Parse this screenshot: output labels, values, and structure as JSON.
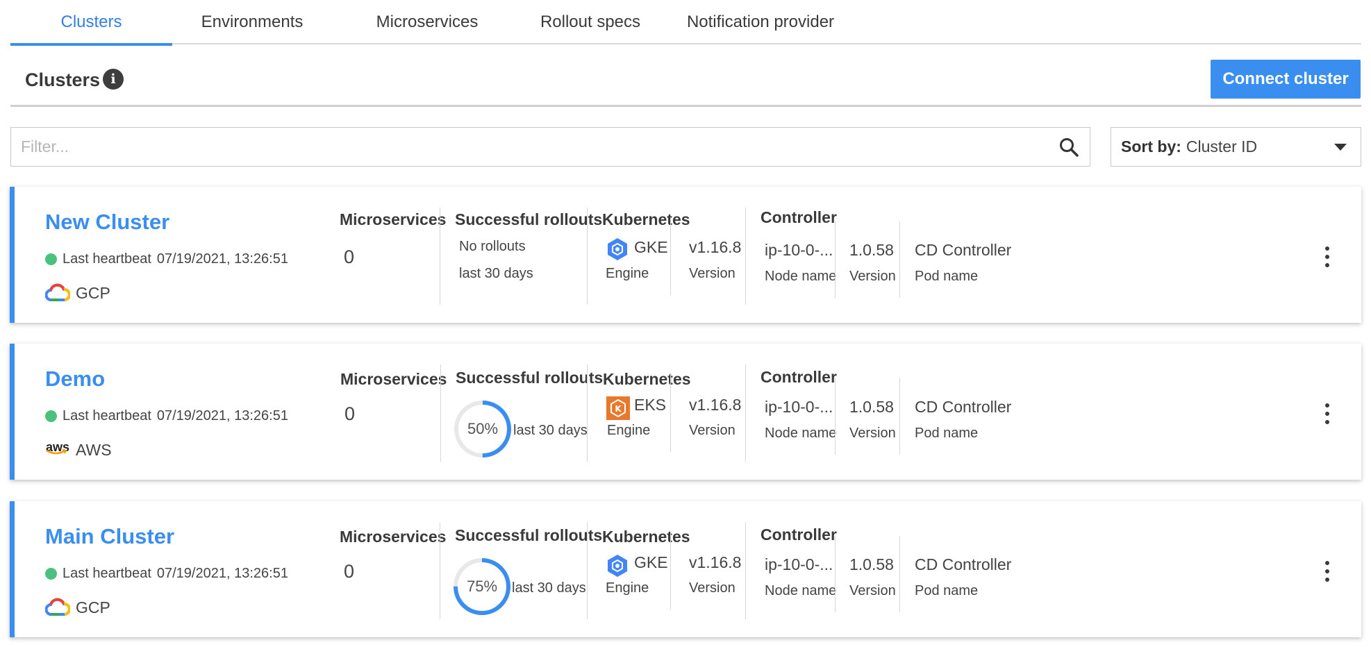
{
  "tabs": [
    {
      "label": "Clusters",
      "active": true
    },
    {
      "label": "Environments",
      "active": false
    },
    {
      "label": "Microservices",
      "active": false
    },
    {
      "label": "Rollout specs",
      "active": false
    },
    {
      "label": "Notification provider",
      "active": false
    }
  ],
  "header": {
    "title": "Clusters",
    "info_icon": "info-icon",
    "connect_button": "Connect cluster"
  },
  "filter": {
    "placeholder": "Filter...",
    "value": "",
    "icon": "search-icon"
  },
  "sort": {
    "label": "Sort by:",
    "value": "Cluster ID",
    "icon": "chevron-down-icon"
  },
  "colors": {
    "accent": "#3a8ef0",
    "status_ok": "#4ac27d",
    "ring_track": "#e8e8e8"
  },
  "clusters": [
    {
      "name": "New Cluster",
      "heartbeat_label": "Last heartbeat",
      "heartbeat_time": "07/19/2021, 13:26:51",
      "provider": "GCP",
      "provider_icon": "gcp-cloud-icon",
      "microservices_label": "Microservices",
      "microservices_count": "0",
      "rollouts_label": "Successful rollouts",
      "rollouts_percent": null,
      "rollouts_text": "No rollouts",
      "rollouts_period": "last 30 days",
      "kubernetes_label": "Kubernetes",
      "engine": "GKE",
      "engine_icon": "gke-icon",
      "engine_label": "Engine",
      "k8s_version": "v1.16.8",
      "version_label": "Version",
      "controller_label": "Controller",
      "node_name": "ip-10-0-...",
      "node_name_label": "Node name",
      "controller_version": "1.0.58",
      "controller_version_label": "Version",
      "pod_name": "CD Controller",
      "pod_name_label": "Pod name"
    },
    {
      "name": "Demo",
      "heartbeat_label": "Last heartbeat",
      "heartbeat_time": "07/19/2021, 13:26:51",
      "provider": "AWS",
      "provider_icon": "aws-logo-icon",
      "provider_logo_text": "aws",
      "microservices_label": "Microservices",
      "microservices_count": "0",
      "rollouts_label": "Successful rollouts",
      "rollouts_percent": 50,
      "rollouts_percent_text": "50%",
      "rollouts_period": "last 30 days",
      "kubernetes_label": "Kubernetes",
      "engine": "EKS",
      "engine_icon": "eks-icon",
      "engine_label": "Engine",
      "k8s_version": "v1.16.8",
      "version_label": "Version",
      "controller_label": "Controller",
      "node_name": "ip-10-0-...",
      "node_name_label": "Node name",
      "controller_version": "1.0.58",
      "controller_version_label": "Version",
      "pod_name": "CD Controller",
      "pod_name_label": "Pod name"
    },
    {
      "name": "Main Cluster",
      "heartbeat_label": "Last heartbeat",
      "heartbeat_time": "07/19/2021, 13:26:51",
      "provider": "GCP",
      "provider_icon": "gcp-cloud-icon",
      "microservices_label": "Microservices",
      "microservices_count": "0",
      "rollouts_label": "Successful rollouts",
      "rollouts_percent": 75,
      "rollouts_percent_text": "75%",
      "rollouts_period": "last 30 days",
      "kubernetes_label": "Kubernetes",
      "engine": "GKE",
      "engine_icon": "gke-icon",
      "engine_label": "Engine",
      "k8s_version": "v1.16.8",
      "version_label": "Version",
      "controller_label": "Controller",
      "node_name": "ip-10-0-...",
      "node_name_label": "Node name",
      "controller_version": "1.0.58",
      "controller_version_label": "Version",
      "pod_name": "CD Controller",
      "pod_name_label": "Pod name"
    }
  ]
}
